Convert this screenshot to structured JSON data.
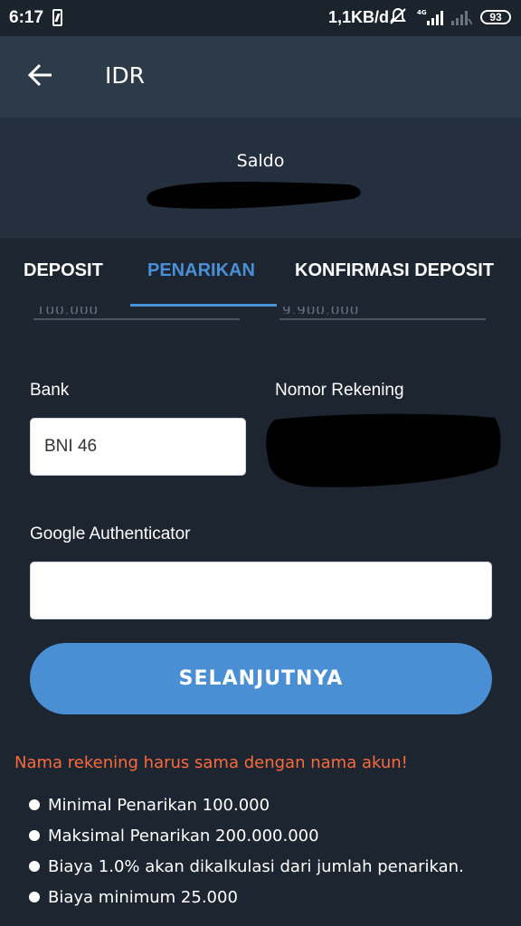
{
  "status_bar": {
    "time": "6:17",
    "network_speed": "1,1KB/d",
    "network_type": "4G",
    "battery": "93"
  },
  "app_bar": {
    "title": "IDR",
    "back_icon": "arrow-left-icon"
  },
  "balance": {
    "label": "Saldo"
  },
  "tabs": [
    {
      "label": "DEPOSIT",
      "active": false
    },
    {
      "label": "PENARIKAN",
      "active": true
    },
    {
      "label": "KONFIRMASI DEPOSIT",
      "active": false
    }
  ],
  "form": {
    "bank_label": "Bank",
    "bank_value": "BNI 46",
    "account_label": "Nomor Rekening",
    "authenticator_label": "Google Authenticator",
    "authenticator_value": "",
    "submit_label": "SELANJUTNYA"
  },
  "faded_values": [
    "100.000",
    "9.900.000"
  ],
  "warning": "Nama rekening harus sama dengan nama akun!",
  "notes": [
    "Minimal Penarikan 100.000",
    "Maksimal Penarikan 200.000.000",
    "Biaya 1.0% akan dikalkulasi dari jumlah penarikan.",
    "Biaya minimum 25.000"
  ],
  "colors": {
    "accent": "#4a8fd3",
    "warning": "#ff6a3d",
    "background": "#1c2530"
  }
}
